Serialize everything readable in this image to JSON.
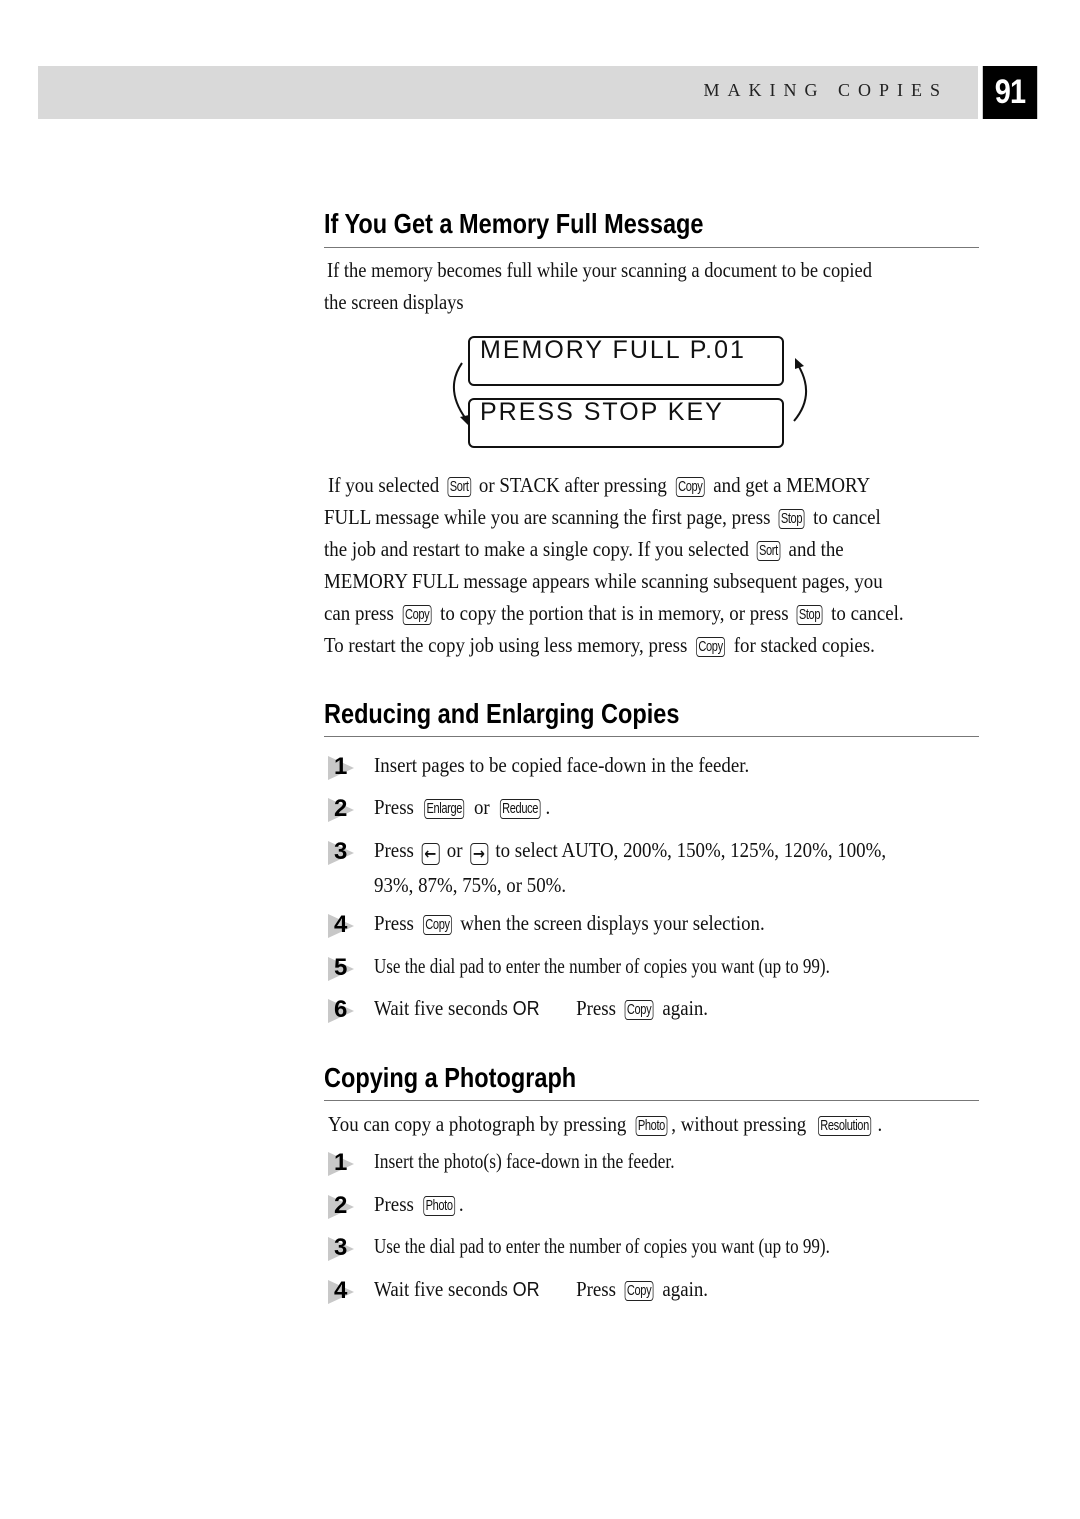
{
  "header": {
    "chapter_title": "MAKING COPIES",
    "page_number": "91"
  },
  "keys": {
    "sort": "Sort",
    "copy": "Copy",
    "stop": "Stop",
    "enlarge": "Enlarge",
    "reduce": "Reduce",
    "photo": "Photo",
    "resolution": "Resolution",
    "left_arrow": "←",
    "right_arrow": "→"
  },
  "memory_full": {
    "title": "If You Get a Memory Full Message",
    "intro_line1": "If the memory becomes full while your scanning a document to be copied",
    "intro_line2": "the screen displays",
    "lcd_line1": "MEMORY FULL P.01",
    "lcd_line2": "PRESS STOP KEY",
    "p_l1_a": "If you selected",
    "p_l1_b": "or STACK after pressing",
    "p_l1_c": "and get a MEMORY",
    "p_l2_a": "FULL message while you are scanning the first page, press",
    "p_l2_b": "to cancel",
    "p_l3_a": "the job and restart to make a single copy.  If you selected",
    "p_l3_b": "and the",
    "p_l4": "MEMORY FULL message appears while scanning subsequent pages, you",
    "p_l5_a": "can press",
    "p_l5_b": "to copy the portion that is in memory, or press",
    "p_l5_c": "to cancel.",
    "p_l6_a": "To restart the copy job using less memory, press",
    "p_l6_b": "for stacked copies."
  },
  "reduce_enlarge": {
    "title": "Reducing and Enlarging Copies",
    "steps": [
      {
        "num": "1",
        "text": "Insert pages to be copied face-down in the feeder."
      },
      {
        "num": "2",
        "pre": "Press",
        "mid": "or",
        "post": "."
      },
      {
        "num": "3",
        "pre": "Press",
        "mid": "or",
        "post": "to select AUTO, 200%, 150%, 125%, 120%, 100%,",
        "line2": "93%, 87%, 75%, or 50%."
      },
      {
        "num": "4",
        "pre": "Press",
        "post": "when the screen displays your selection."
      },
      {
        "num": "5",
        "text": "Use the dial pad to enter the number of copies you want (up to 99)."
      },
      {
        "num": "6",
        "pre": "Wait five seconds",
        "or": "OR",
        "mid": "Press",
        "post": "again."
      }
    ]
  },
  "photograph": {
    "title": "Copying a Photograph",
    "intro_a": "You can copy a photograph by pressing",
    "intro_b": ", without pressing",
    "intro_c": ".",
    "steps": [
      {
        "num": "1",
        "text": "Insert the photo(s) face-down in the feeder."
      },
      {
        "num": "2",
        "pre": "Press",
        "post": "."
      },
      {
        "num": "3",
        "text": "Use the dial pad to enter the number of copies you want (up to 99)."
      },
      {
        "num": "4",
        "pre": "Wait five seconds",
        "or": "OR",
        "mid": "Press",
        "post": "again."
      }
    ]
  }
}
